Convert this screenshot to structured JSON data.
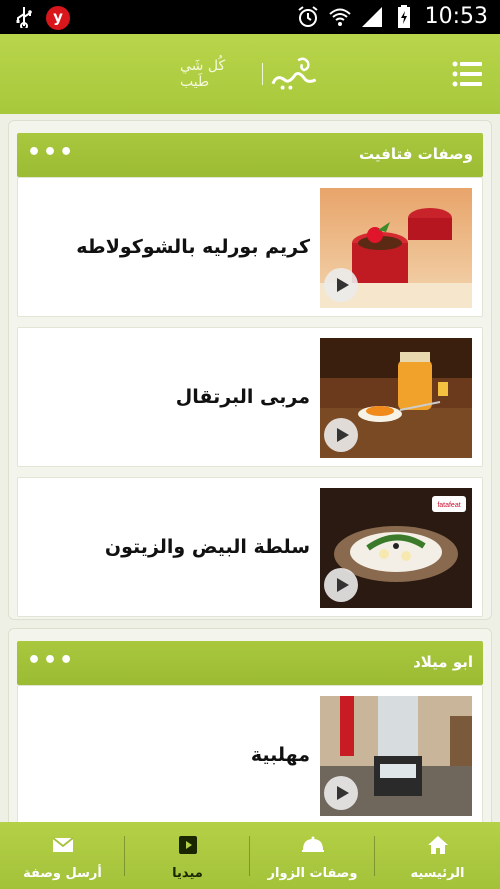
{
  "status_bar": {
    "time": "10:53",
    "notification_app": "y",
    "icons": [
      "usb-icon",
      "yandex-icon",
      "alarm-icon",
      "wifi-icon",
      "signal-icon",
      "battery-icon"
    ]
  },
  "app_bar": {
    "logo_tagline": "كُل شَي طَيب",
    "menu_icon": "menu-list-icon"
  },
  "sections": [
    {
      "title": "وصفات فتافيت",
      "more": "•••",
      "items": [
        {
          "title": "كريم بورليه بالشوكولاطه"
        },
        {
          "title": "مربى البرتقال"
        },
        {
          "title": "سلطة البيض والزيتون",
          "thumb_badge": "fatafeat"
        }
      ]
    },
    {
      "title": "ابو ميلاد",
      "more": "•••",
      "items": [
        {
          "title": "مهلبية"
        }
      ]
    }
  ],
  "bottom_nav": [
    {
      "label": "الرئيسيه",
      "icon": "home-icon"
    },
    {
      "label": "وصفات الزوار",
      "icon": "cloche-icon"
    },
    {
      "label": "ميديا",
      "icon": "play-icon",
      "active": true
    },
    {
      "label": "أرسل وصفة",
      "icon": "envelope-icon"
    }
  ],
  "colors": {
    "accent_green": "#a8c83b",
    "status_bar": "#000000",
    "background": "#eef0e6"
  }
}
